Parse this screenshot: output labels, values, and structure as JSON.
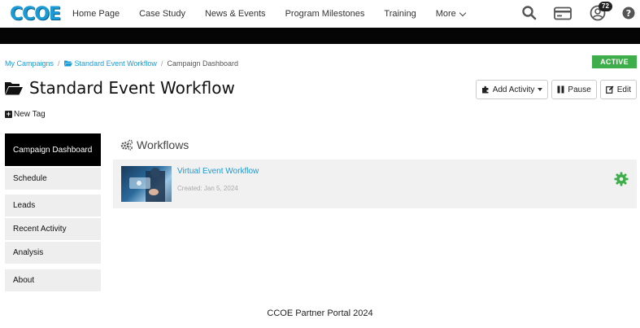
{
  "brand": {
    "logo_text": "CCOE"
  },
  "nav": {
    "links": [
      "Home Page",
      "Case Study",
      "News & Events",
      "Program Milestones",
      "Training"
    ],
    "more_label": "More",
    "notification_count": "72"
  },
  "breadcrumb": {
    "items": [
      "My Campaigns",
      "Standard Event Workflow"
    ],
    "current": "Campaign Dashboard"
  },
  "campaign": {
    "status": "ACTIVE",
    "title": "Standard Event Workflow",
    "new_tag_label": "New Tag"
  },
  "actions": {
    "add_activity": "Add Activity",
    "pause": "Pause",
    "edit": "Edit"
  },
  "sidebar": {
    "items": [
      {
        "label": "Campaign Dashboard",
        "active": true
      },
      {
        "label": "Schedule"
      },
      {
        "label": "Leads"
      },
      {
        "label": "Recent Activity"
      },
      {
        "label": "Analysis"
      },
      {
        "label": "About"
      }
    ]
  },
  "workflows": {
    "heading": "Workflows",
    "items": [
      {
        "name": "Virtual Event Workflow",
        "created": "Created: Jan 5, 2024"
      }
    ]
  },
  "footer": {
    "text": "CCOE Partner Portal 2024"
  },
  "colors": {
    "accent": "#1a9bd7",
    "status_active": "#3dae4a",
    "sidebar_active": "#000000",
    "gear": "#3dae4a"
  }
}
